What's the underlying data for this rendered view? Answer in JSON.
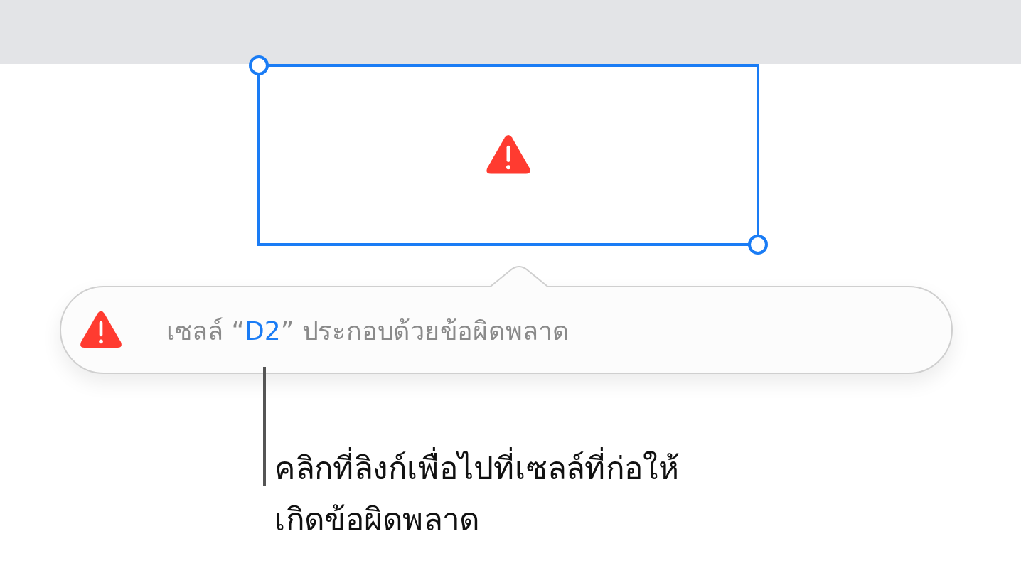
{
  "cell": {
    "selected": true,
    "error": true
  },
  "popover": {
    "message_before": "เซลล์ “",
    "link": "D2",
    "message_after": "” ประกอบด้วยข้อผิดพลาด"
  },
  "callout": {
    "lines": [
      "คลิกที่ลิงก์เพื่อไปที่เซลล์ที่ก่อให้",
      "เกิดข้อผิดพลาด"
    ]
  }
}
